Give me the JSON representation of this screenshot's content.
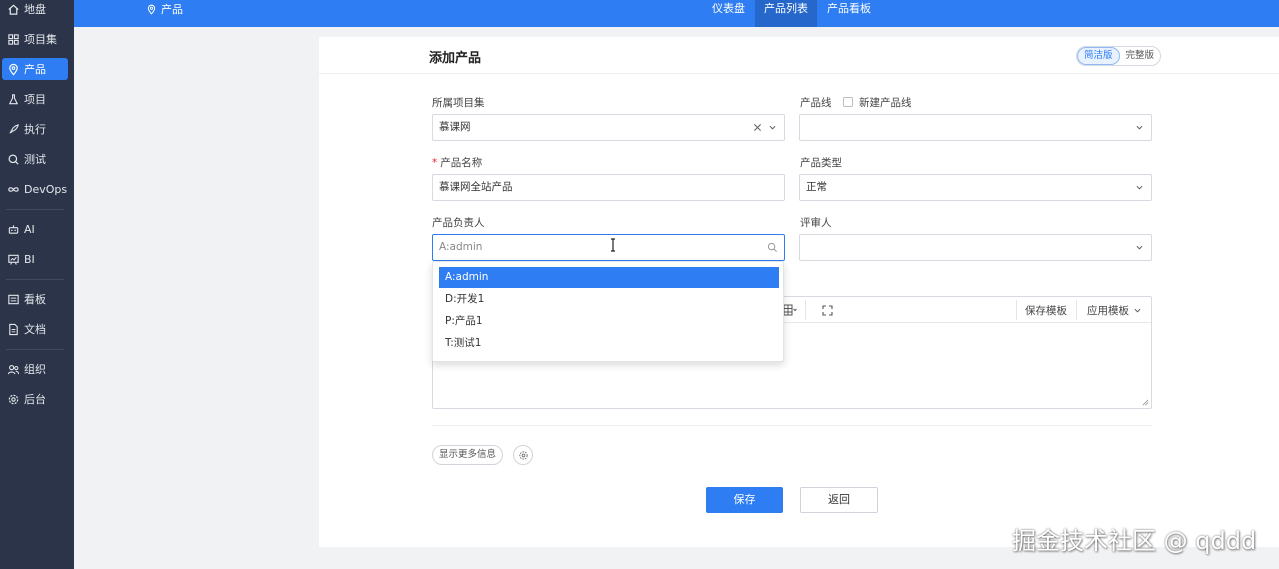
{
  "sidebar": {
    "items": [
      {
        "label": "地盘",
        "icon": "home-icon"
      },
      {
        "label": "项目集",
        "icon": "grid-icon"
      },
      {
        "label": "产品",
        "icon": "location-pin-icon",
        "active": true
      },
      {
        "label": "项目",
        "icon": "flask-icon"
      },
      {
        "label": "执行",
        "icon": "rocket-icon"
      },
      {
        "label": "测试",
        "icon": "search-check-icon"
      },
      {
        "label": "DevOps",
        "icon": "infinity-icon"
      },
      {
        "label": "AI",
        "icon": "robot-icon"
      },
      {
        "label": "BI",
        "icon": "chart-board-icon"
      },
      {
        "label": "看板",
        "icon": "kanban-icon"
      },
      {
        "label": "文档",
        "icon": "document-icon"
      },
      {
        "label": "组织",
        "icon": "people-icon"
      },
      {
        "label": "后台",
        "icon": "gear-icon"
      }
    ]
  },
  "topbar": {
    "breadcrumb": "产品",
    "nav": [
      {
        "label": "仪表盘"
      },
      {
        "label": "产品列表",
        "active": true
      },
      {
        "label": "产品看板"
      }
    ]
  },
  "form": {
    "title": "添加产品",
    "version_switch": {
      "simple": "简洁版",
      "full": "完整版"
    },
    "program_label": "所属项目集",
    "program_value": "慕课网",
    "line_label": "产品线",
    "new_line_label": "新建产品线",
    "line_value": "",
    "name_label": "产品名称",
    "name_value": "慕课网全站产品",
    "type_label": "产品类型",
    "type_value": "正常",
    "owner_label": "产品负责人",
    "owner_value": "A:admin",
    "reviewer_label": "评审人",
    "reviewer_value": "",
    "editor_toolbar": {
      "save_template": "保存模板",
      "apply_template": "应用模板"
    },
    "more_info": "显示更多信息",
    "save": "保存",
    "back": "返回"
  },
  "owner_dropdown": {
    "options": [
      "A:admin",
      "D:开发1",
      "P:产品1",
      "T:测试1"
    ],
    "selected_index": 0
  },
  "watermark": "掘金技术社区 @ qddd",
  "colors": {
    "accent": "#2e7df2",
    "sidebar": "#2b3448",
    "page_bg": "#f1f2f4"
  }
}
